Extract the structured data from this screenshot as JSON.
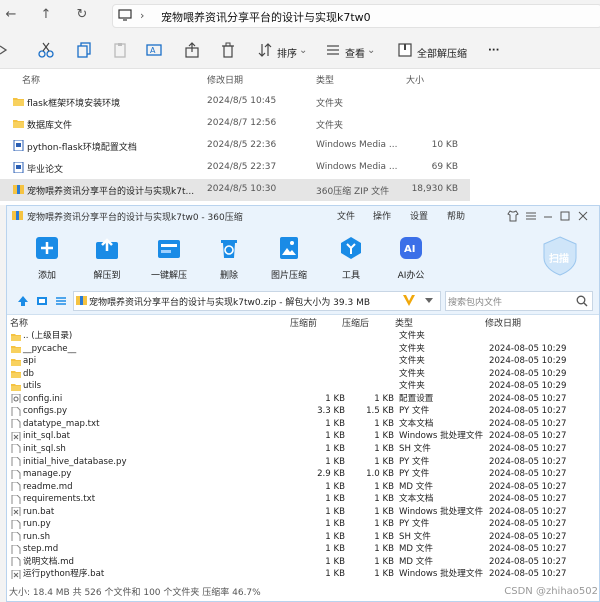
{
  "explorer": {
    "path": "宠物喂养资讯分享平台的设计与实现k7tw0",
    "toolbar": {
      "sort": "排序",
      "view": "查看",
      "extract_all": "全部解压缩",
      "more": "···"
    },
    "columns": {
      "name": "名称",
      "modified": "修改日期",
      "type": "类型",
      "size": "大小"
    },
    "files": [
      {
        "name": "flask框架环境安装环境",
        "date": "2024/8/5 10:45",
        "type": "文件夹",
        "size": "",
        "icon": "folder-icon"
      },
      {
        "name": "数据库文件",
        "date": "2024/8/7 12:56",
        "type": "文件夹",
        "size": "",
        "icon": "folder-icon"
      },
      {
        "name": "python-flask环境配置文档",
        "date": "2024/8/5 22:36",
        "type": "Windows Media ...",
        "size": "10 KB",
        "icon": "document-icon"
      },
      {
        "name": "毕业论文",
        "date": "2024/8/5 22:37",
        "type": "Windows Media ...",
        "size": "69 KB",
        "icon": "document-icon"
      },
      {
        "name": "宠物喂养资讯分享平台的设计与实现k7t...",
        "date": "2024/8/5 10:30",
        "type": "360压缩 ZIP 文件",
        "size": "18,930 KB",
        "icon": "zip-icon"
      }
    ]
  },
  "zip": {
    "title": "宠物喂养资讯分享平台的设计与实现k7tw0 - 360压缩",
    "menu": [
      "文件",
      "操作",
      "设置",
      "帮助"
    ],
    "tools": [
      "添加",
      "解压到",
      "一键解压",
      "删除",
      "图片压缩",
      "工具",
      "AI办公"
    ],
    "scan": "扫描",
    "address": "宠物喂养资讯分享平台的设计与实现k7tw0.zip - 解包大小为 39.3 MB",
    "search_placeholder": "搜索包内文件",
    "columns": {
      "name": "名称",
      "packed": "压缩前",
      "size": "压缩后",
      "type": "类型",
      "modified": "修改日期"
    },
    "rows": [
      {
        "name": ".. (上级目录)",
        "packed": "",
        "size": "",
        "type": "文件夹",
        "date": "",
        "icon": "folder-icon"
      },
      {
        "name": "__pycache__",
        "packed": "",
        "size": "",
        "type": "文件夹",
        "date": "2024-08-05 10:29",
        "icon": "folder-icon"
      },
      {
        "name": "api",
        "packed": "",
        "size": "",
        "type": "文件夹",
        "date": "2024-08-05 10:29",
        "icon": "folder-icon"
      },
      {
        "name": "db",
        "packed": "",
        "size": "",
        "type": "文件夹",
        "date": "2024-08-05 10:29",
        "icon": "folder-icon"
      },
      {
        "name": "utils",
        "packed": "",
        "size": "",
        "type": "文件夹",
        "date": "2024-08-05 10:29",
        "icon": "folder-icon"
      },
      {
        "name": "config.ini",
        "packed": "1 KB",
        "size": "1 KB",
        "type": "配置设置",
        "date": "2024-08-05 10:27",
        "icon": "config-icon"
      },
      {
        "name": "configs.py",
        "packed": "3.3 KB",
        "size": "1.5 KB",
        "type": "PY 文件",
        "date": "2024-08-05 10:27",
        "icon": "file-icon"
      },
      {
        "name": "datatype_map.txt",
        "packed": "1 KB",
        "size": "1 KB",
        "type": "文本文档",
        "date": "2024-08-05 10:27",
        "icon": "file-icon"
      },
      {
        "name": "init_sql.bat",
        "packed": "1 KB",
        "size": "1 KB",
        "type": "Windows 批处理文件",
        "date": "2024-08-05 10:27",
        "icon": "batch-icon"
      },
      {
        "name": "init_sql.sh",
        "packed": "1 KB",
        "size": "1 KB",
        "type": "SH 文件",
        "date": "2024-08-05 10:27",
        "icon": "file-icon"
      },
      {
        "name": "initial_hive_database.py",
        "packed": "1 KB",
        "size": "1 KB",
        "type": "PY 文件",
        "date": "2024-08-05 10:27",
        "icon": "file-icon"
      },
      {
        "name": "manage.py",
        "packed": "2.9 KB",
        "size": "1.0 KB",
        "type": "PY 文件",
        "date": "2024-08-05 10:27",
        "icon": "file-icon"
      },
      {
        "name": "readme.md",
        "packed": "1 KB",
        "size": "1 KB",
        "type": "MD 文件",
        "date": "2024-08-05 10:27",
        "icon": "file-icon"
      },
      {
        "name": "requirements.txt",
        "packed": "1 KB",
        "size": "1 KB",
        "type": "文本文档",
        "date": "2024-08-05 10:27",
        "icon": "file-icon"
      },
      {
        "name": "run.bat",
        "packed": "1 KB",
        "size": "1 KB",
        "type": "Windows 批处理文件",
        "date": "2024-08-05 10:27",
        "icon": "batch-icon"
      },
      {
        "name": "run.py",
        "packed": "1 KB",
        "size": "1 KB",
        "type": "PY 文件",
        "date": "2024-08-05 10:27",
        "icon": "file-icon"
      },
      {
        "name": "run.sh",
        "packed": "1 KB",
        "size": "1 KB",
        "type": "SH 文件",
        "date": "2024-08-05 10:27",
        "icon": "file-icon"
      },
      {
        "name": "step.md",
        "packed": "1 KB",
        "size": "1 KB",
        "type": "MD 文件",
        "date": "2024-08-05 10:27",
        "icon": "file-icon"
      },
      {
        "name": "说明文档.md",
        "packed": "1 KB",
        "size": "1 KB",
        "type": "MD 文件",
        "date": "2024-08-05 10:27",
        "icon": "file-icon"
      },
      {
        "name": "运行python程序.bat",
        "packed": "1 KB",
        "size": "1 KB",
        "type": "Windows 批处理文件",
        "date": "2024-08-05 10:27",
        "icon": "batch-icon"
      }
    ],
    "status": "大小: 18.4 MB 共 526 个文件和 100 个文件夹 压缩率 46.7%"
  },
  "watermark": "CSDN @zhihao502",
  "colors": {
    "accent": "#1a8be6",
    "folder": "#f5c342",
    "zip_title_bg": "#eaf3fc"
  }
}
